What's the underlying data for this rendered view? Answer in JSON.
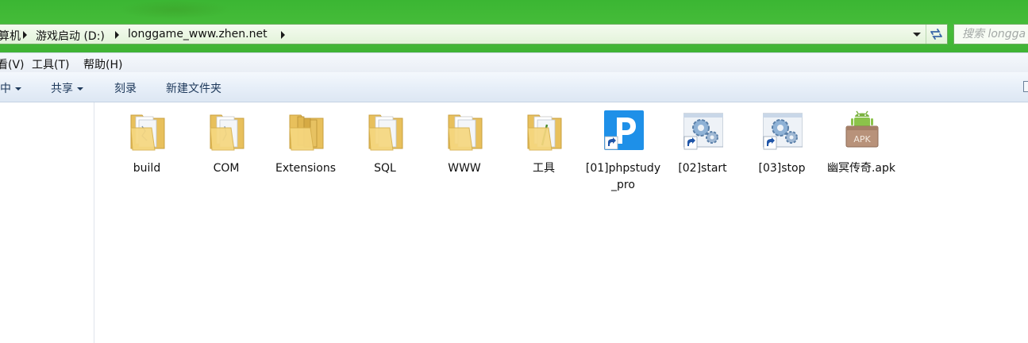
{
  "address_bar": {
    "breadcrumbs": [
      "算机",
      "游戏启动 (D:)",
      "longgame_www.zhen.net"
    ],
    "search_placeholder": "搜索 longga"
  },
  "menu": {
    "items": [
      "看(V)",
      "工具(T)",
      "帮助(H)"
    ]
  },
  "toolbar": {
    "buttons": [
      "中",
      "共享",
      "刻录",
      "新建文件夹"
    ]
  },
  "files": [
    {
      "name": "build",
      "icon": "folder-icon"
    },
    {
      "name": "COM",
      "icon": "folder-icon"
    },
    {
      "name": "Extensions",
      "icon": "folder-icon"
    },
    {
      "name": "SQL",
      "icon": "folder-icon"
    },
    {
      "name": "WWW",
      "icon": "folder-icon"
    },
    {
      "name": "工具",
      "icon": "folder-icon"
    },
    {
      "name": "[01]phpstudy_pro",
      "icon": "phpstudy-shortcut-icon"
    },
    {
      "name": "[02]start",
      "icon": "gears-shortcut-icon"
    },
    {
      "name": "[03]stop",
      "icon": "gears-shortcut-icon"
    },
    {
      "name": "幽冥传奇.apk",
      "icon": "apk-icon"
    }
  ],
  "colors": {
    "title_green": "#47bd3a",
    "address_bg": "#e3f3da",
    "phpstudy_blue": "#2196f3",
    "apk_green": "#8bc34a",
    "apk_box": "#b9967a",
    "folder": "#f3d37a"
  }
}
